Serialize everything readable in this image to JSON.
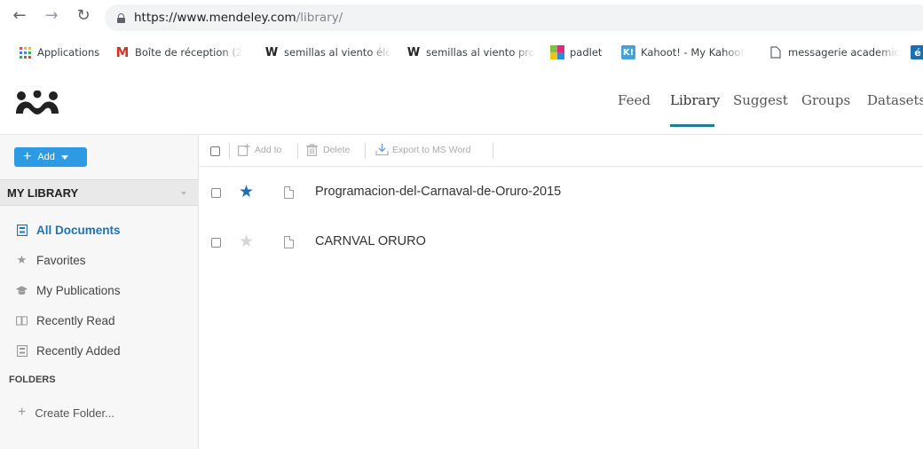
{
  "browser": {
    "back_icon": "arrow-left-icon",
    "forward_icon": "arrow-right-icon",
    "reload_icon": "reload-icon",
    "url_host": "https://www.mendeley.com",
    "url_path": "/library/",
    "bookmarks": [
      {
        "label": "Applications",
        "icon": "apps-grid-icon"
      },
      {
        "label": "Boîte de réception (2",
        "icon": "gmail-icon"
      },
      {
        "label": "semillas al viento élè",
        "icon": "w-icon"
      },
      {
        "label": "semillas al viento pro",
        "icon": "w-icon"
      },
      {
        "label": "padlet",
        "icon": "padlet-icon"
      },
      {
        "label": "Kahoot! - My Kahoot",
        "icon": "kahoot-icon"
      },
      {
        "label": "messagerie academic",
        "icon": "page-icon"
      },
      {
        "label": "é",
        "icon": "partial-icon"
      }
    ]
  },
  "header": {
    "logo": "mendeley-logo",
    "nav": [
      {
        "label": "Feed",
        "active": false
      },
      {
        "label": "Library",
        "active": true
      },
      {
        "label": "Suggest",
        "active": false
      },
      {
        "label": "Groups",
        "active": false
      },
      {
        "label": "Datasets",
        "active": false
      }
    ]
  },
  "sidebar": {
    "add_label": "Add",
    "section_title": "MY LIBRARY",
    "items": [
      {
        "label": "All Documents",
        "icon": "all-documents-icon",
        "active": true
      },
      {
        "label": "Favorites",
        "icon": "star-icon",
        "active": false
      },
      {
        "label": "My Publications",
        "icon": "graduation-cap-icon",
        "active": false
      },
      {
        "label": "Recently Read",
        "icon": "open-book-icon",
        "active": false
      },
      {
        "label": "Recently Added",
        "icon": "recently-added-icon",
        "active": false
      }
    ],
    "folders_title": "FOLDERS",
    "create_folder_label": "Create Folder..."
  },
  "toolbar": {
    "add_to_label": "Add to",
    "delete_label": "Delete",
    "export_label": "Export to MS Word"
  },
  "documents": [
    {
      "title": "Programacion-del-Carnaval-de-Oruro-2015",
      "favorite": true
    },
    {
      "title": "CARNVAL ORURO",
      "favorite": false
    }
  ],
  "colors": {
    "accent_blue": "#2e9ae3",
    "active_link": "#1e73b8",
    "star_active": "#1f6fb2",
    "star_inactive": "#d5d5d5",
    "nav_underline": "#1d7d96"
  }
}
